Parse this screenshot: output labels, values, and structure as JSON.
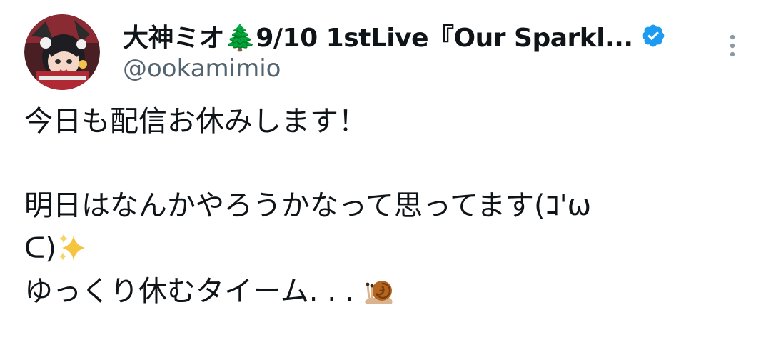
{
  "author": {
    "display_name": "大神ミオ🌲9/10 1stLive『Our Sparkl...",
    "handle": "@ookamimio",
    "verified": true,
    "avatar_icon": "profile-avatar-icon"
  },
  "menu": {
    "more_icon": "more-vertical-icon"
  },
  "tweet": {
    "line1": "今日も配信お休みします！",
    "line2": "明日はなんかやろうかなって思ってます(ｺ'ω",
    "line3_text": "ᑕ)",
    "line3_emoji": "sparkles-icon",
    "line4_text": "ゆっくり休むタイーム. . . ",
    "line4_emoji": "snail-icon"
  },
  "colors": {
    "text_primary": "#0f1419",
    "text_secondary": "#536471",
    "verified_blue": "#1d9bf0",
    "sparkle_gold": "#f5c542"
  }
}
